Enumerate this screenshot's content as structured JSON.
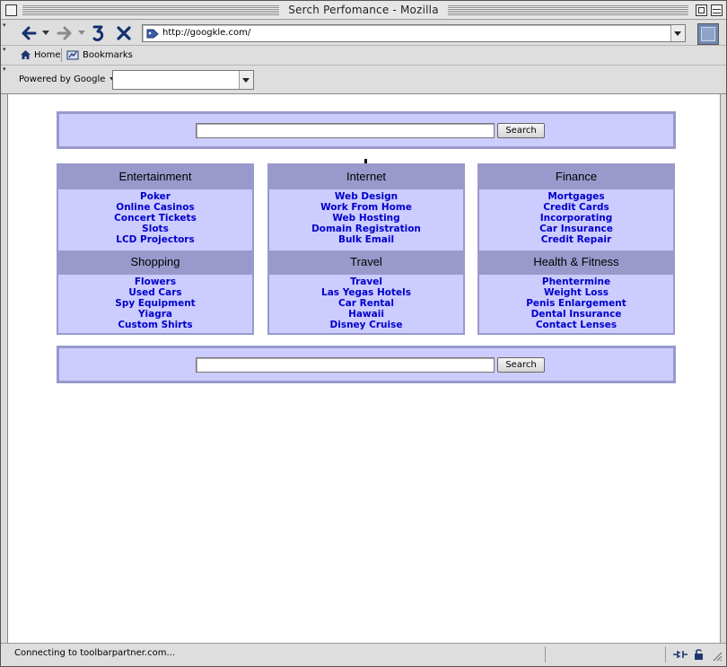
{
  "window": {
    "title": "Serch Perfomance - Mozilla"
  },
  "nav": {
    "url": "http://googkle.com/",
    "back_icon": "back-arrow-icon",
    "forward_icon": "forward-arrow-icon",
    "reload_icon": "reload-icon",
    "stop_icon": "stop-x-icon"
  },
  "personal_toolbar": {
    "home_label": "Home",
    "bookmarks_label": "Bookmarks"
  },
  "google_toolbar": {
    "powered_label": "Powered by Google",
    "search_value": ""
  },
  "page": {
    "top_search": {
      "value": "",
      "button_label": "Search"
    },
    "bottom_search": {
      "value": "",
      "button_label": "Search"
    },
    "link_color": "#0000cc",
    "box_fill": "#ccccff",
    "header_fill": "#9999cc",
    "columns": [
      {
        "sections": [
          {
            "title": "Entertainment",
            "links": [
              "Poker",
              "Online Casinos",
              "Concert Tickets",
              "Slots",
              "LCD Projectors"
            ]
          },
          {
            "title": "Shopping",
            "links": [
              "Flowers",
              "Used Cars",
              "Spy Equipment",
              "Yiagra",
              "Custom Shirts"
            ]
          }
        ]
      },
      {
        "sections": [
          {
            "title": "Internet",
            "links": [
              "Web Design",
              "Work From Home",
              "Web Hosting",
              "Domain Registration",
              "Bulk Email"
            ]
          },
          {
            "title": "Travel",
            "links": [
              "Travel",
              "Las Yegas Hotels",
              "Car Rental",
              "Hawaii",
              "Disney Cruise"
            ]
          }
        ]
      },
      {
        "sections": [
          {
            "title": "Finance",
            "links": [
              "Mortgages",
              "Credit Cards",
              "Incorporating",
              "Car Insurance",
              "Credit Repair"
            ]
          },
          {
            "title": "Health & Fitness",
            "links": [
              "Phentermine",
              "Weight Loss",
              "Penis Enlargement",
              "Dental Insurance",
              "Contact Lenses"
            ]
          }
        ]
      }
    ]
  },
  "status": {
    "text": "Connecting to toolbarpartner.com..."
  }
}
